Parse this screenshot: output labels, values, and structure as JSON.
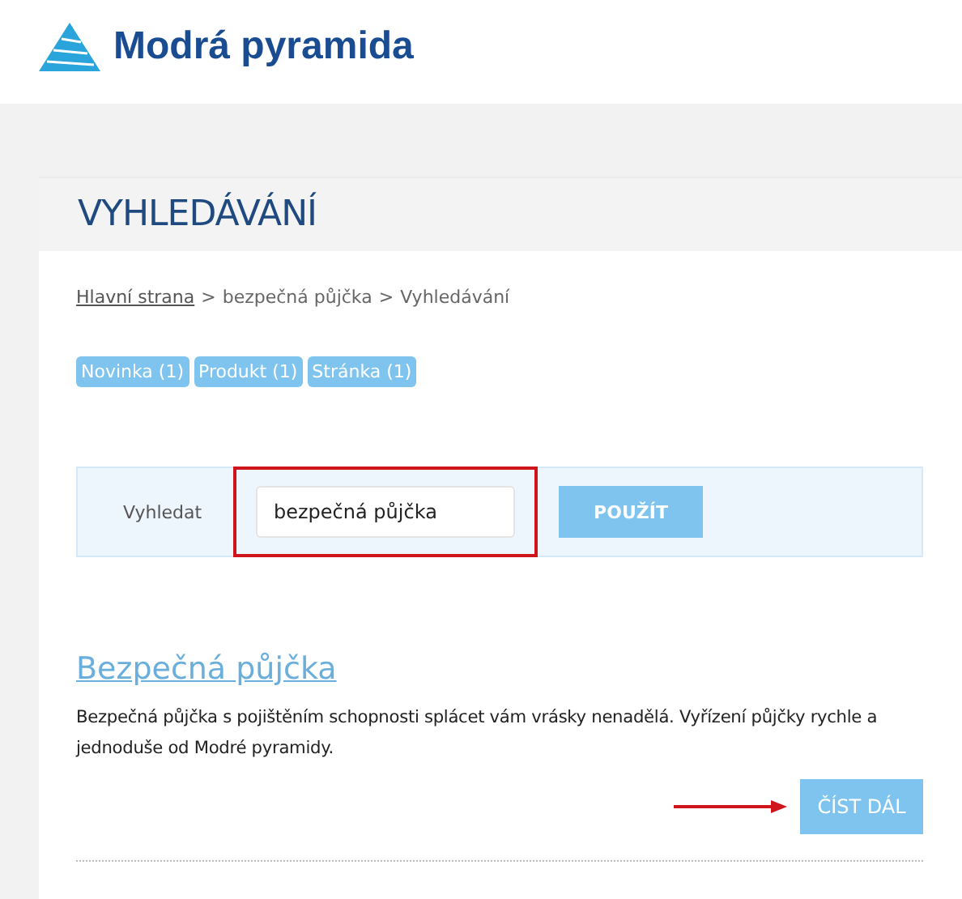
{
  "logo": {
    "text": "Modrá pyramida"
  },
  "page_title": "VYHLEDÁVÁNÍ",
  "breadcrumb": [
    {
      "label": "Hlavní strana",
      "link": true
    },
    {
      "label": "bezpečná půjčka",
      "link": false
    },
    {
      "label": "Vyhledávání",
      "link": false
    }
  ],
  "breadcrumb_separator": ">",
  "filters": [
    {
      "label": "Novinka (1)"
    },
    {
      "label": "Produkt (1)"
    },
    {
      "label": "Stránka (1)"
    }
  ],
  "search": {
    "label": "Vyhledat",
    "value": "bezpečná půjčka",
    "highlighted": true,
    "button": "POUŽÍT"
  },
  "results": [
    {
      "title": "Bezpečná půjčka",
      "description": "Bezpečná půjčka s pojištěním schopnosti splácet vám vrásky nenadělá. Vyřízení půjčky rychle a jednoduše od Modré pyramidy.",
      "button": "ČÍST DÁL",
      "arrow": true
    }
  ]
}
